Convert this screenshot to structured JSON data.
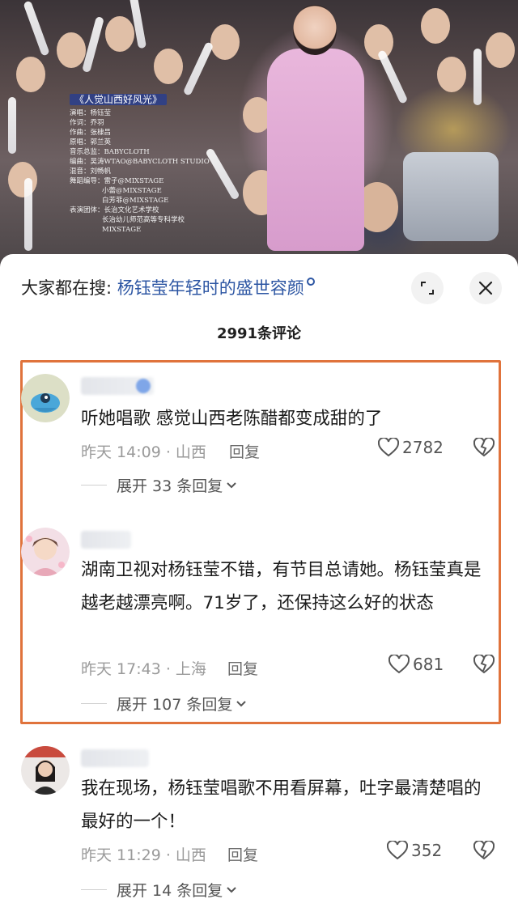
{
  "video": {
    "song_title": "《人觉山西好风光》",
    "credits": [
      "演唱：杨钰莹",
      "作词：乔羽",
      "作曲：张棣昌",
      "原唱：郭兰英",
      "音乐总监：BABYCLOTH",
      "编曲：吴涛WTAO@BABYCLOTH STUDIO",
      "混音：刘畅帆",
      "舞蹈编导：雷子@MIXSTAGE",
      "小蕾@MIXSTAGE",
      "白芳菲@MIXSTAGE",
      "表演团体：长治文化艺术学校",
      "长治幼儿师范高等专科学校",
      "MIXSTAGE"
    ]
  },
  "sheet": {
    "search_prefix": "大家都在搜: ",
    "search_term": "杨钰莹年轻时的盛世容颜",
    "comment_count": "2991条评论",
    "close_icon": "close-icon",
    "expand_icon": "fullscreen-icon"
  },
  "comments": [
    {
      "text": "听她唱歌 感觉山西老陈醋都变成甜的了",
      "time": "昨天 14:09 · 山西",
      "reply": "回复",
      "likes": "2782",
      "expand": "展开 33 条回复"
    },
    {
      "text": "湖南卫视对杨钰莹不错，有节目总请她。杨钰莹真是越老越漂亮啊。71岁了，还保持这么好的状态",
      "time": "昨天 17:43 · 上海",
      "reply": "回复",
      "likes": "681",
      "expand": "展开 107 条回复"
    },
    {
      "text": "我在现场，杨钰莹唱歌不用看屏幕，吐字最清楚唱的最好的一个！",
      "time": "昨天 11:29 · 山西",
      "reply": "回复",
      "likes": "352",
      "expand": "展开 14 条回复"
    }
  ],
  "colors": {
    "highlight_border": "#e0733c",
    "search_term": "#2d56a3"
  }
}
